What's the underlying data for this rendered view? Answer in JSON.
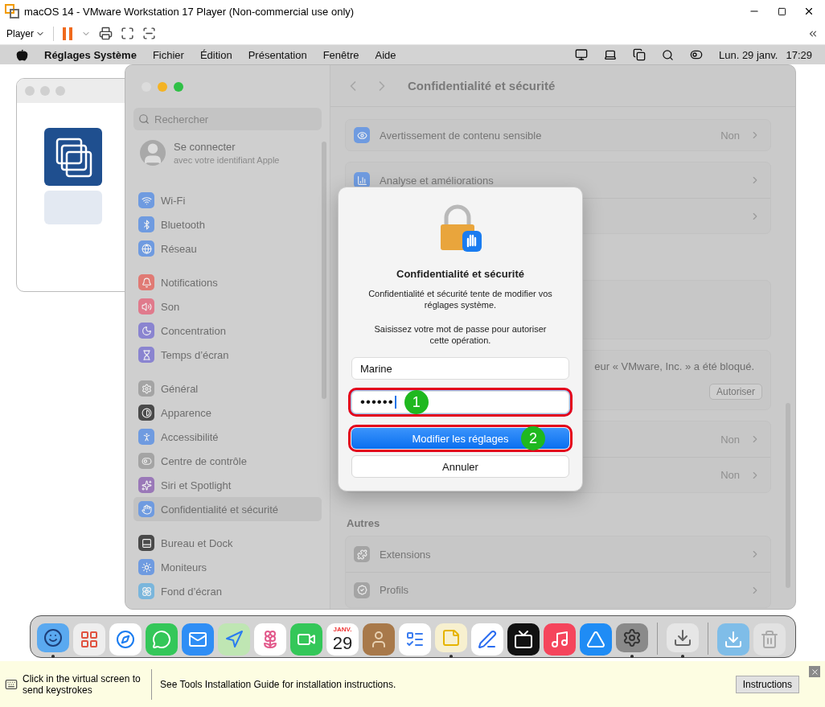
{
  "host_window": {
    "title": "macOS 14 - VMware Workstation 17 Player (Non-commercial use only)"
  },
  "toolbar": {
    "player_menu": "Player"
  },
  "menu_bar": {
    "app": "Réglages Système",
    "items": [
      "Fichier",
      "Édition",
      "Présentation",
      "Fenêtre",
      "Aide"
    ],
    "date": "Lun. 29 janv.",
    "time": "17:29"
  },
  "settings": {
    "search": {
      "placeholder": "Rechercher"
    },
    "account": {
      "title": "Se connecter",
      "subtitle": "avec votre identifiant Apple"
    },
    "sidebar_groups": [
      [
        {
          "kind": "wifi",
          "label": "Wi-Fi",
          "color": "#6f9be0",
          "selected": false
        },
        {
          "kind": "bluetooth",
          "label": "Bluetooth",
          "color": "#6f9be0",
          "selected": false
        },
        {
          "kind": "globe",
          "label": "Réseau",
          "color": "#6f9be0",
          "selected": false
        }
      ],
      [
        {
          "kind": "bell",
          "label": "Notifications",
          "color": "#e07a74",
          "selected": false
        },
        {
          "kind": "speaker",
          "label": "Son",
          "color": "#e07a8c",
          "selected": false
        },
        {
          "kind": "moon",
          "label": "Concentration",
          "color": "#8a84d0",
          "selected": false
        },
        {
          "kind": "hourglass",
          "label": "Temps d’écran",
          "color": "#8a84d0",
          "selected": false
        }
      ],
      [
        {
          "kind": "gear",
          "label": "Général",
          "color": "#a4a4a4",
          "selected": false
        },
        {
          "kind": "contrast",
          "label": "Apparence",
          "color": "#4a4a4a",
          "selected": false
        },
        {
          "kind": "person",
          "label": "Accessibilité",
          "color": "#6f9be0",
          "selected": false
        },
        {
          "kind": "toggles",
          "label": "Centre de contrôle",
          "color": "#a4a4a4",
          "selected": false
        },
        {
          "kind": "siri",
          "label": "Siri et Spotlight",
          "color": "#9a78b8",
          "selected": false
        },
        {
          "kind": "hand",
          "label": "Confidentialité et sécurité",
          "color": "#6f9be0",
          "selected": true
        }
      ],
      [
        {
          "kind": "dock",
          "label": "Bureau et Dock",
          "color": "#4a4a4a",
          "selected": false
        },
        {
          "kind": "sun",
          "label": "Moniteurs",
          "color": "#6f9be0",
          "selected": false
        },
        {
          "kind": "flower",
          "label": "Fond d’écran",
          "color": "#7ab6dc",
          "selected": false
        }
      ]
    ],
    "content": {
      "title": "Confidentialité et sécurité",
      "cards": [
        {
          "rows": [
            {
              "kind": "eye",
              "label": "Avertissement de contenu sensible",
              "value": "Non"
            }
          ]
        },
        {
          "rows": [
            {
              "kind": "chart",
              "label": "Analyse et améliorations"
            },
            {
              "kind": "blank"
            }
          ]
        },
        {
          "rows": [
            {
              "kind": "empty"
            }
          ]
        },
        {
          "rows": [
            {
              "kind": "notice",
              "label": "eur « VMware, Inc. » a été bloqué.",
              "action": "Autoriser"
            }
          ]
        },
        {
          "rows": [
            {
              "kind": "blank",
              "value": "Non"
            },
            {
              "kind": "blank",
              "value": "Non"
            }
          ]
        },
        {
          "heading": "Autres",
          "rows": [
            {
              "kind": "puzzle",
              "label": "Extensions"
            },
            {
              "kind": "badge",
              "label": "Profils"
            }
          ]
        }
      ]
    }
  },
  "dialog": {
    "title": "Confidentialité et sécurité",
    "message": "Confidentialité et sécurité tente de modifier vos réglages système.",
    "prompt": "Saisissez votre mot de passe pour autoriser cette opération.",
    "username": {
      "value": "Marine",
      "highlighted": false
    },
    "password": {
      "value": "••••••",
      "focused": true,
      "highlighted": true,
      "step": "1"
    },
    "confirm": {
      "label": "Modifier les réglages",
      "highlighted": true,
      "step": "2"
    },
    "cancel": {
      "label": "Annuler"
    }
  },
  "dock": {
    "items": [
      {
        "kind": "finder",
        "running": true
      },
      {
        "kind": "launchpad",
        "running": false
      },
      {
        "kind": "safari",
        "running": false
      },
      {
        "kind": "messages",
        "running": false
      },
      {
        "kind": "mail",
        "running": false
      },
      {
        "kind": "maps",
        "running": false
      },
      {
        "kind": "photos",
        "running": false
      },
      {
        "kind": "facetime",
        "running": false
      },
      {
        "kind": "calendar",
        "running": false,
        "month": "JANV.",
        "day": "29"
      },
      {
        "kind": "contacts",
        "running": false
      },
      {
        "kind": "reminders",
        "running": false
      },
      {
        "kind": "notes",
        "running": true
      },
      {
        "kind": "freeform",
        "running": false
      },
      {
        "kind": "tv",
        "running": false
      },
      {
        "kind": "music",
        "running": false
      },
      {
        "kind": "appstore",
        "running": false
      },
      {
        "kind": "settings",
        "running": true
      },
      {
        "kind": "separator"
      },
      {
        "kind": "installer",
        "running": true
      },
      {
        "kind": "separator"
      },
      {
        "kind": "downloads",
        "running": false
      },
      {
        "kind": "trash",
        "running": false
      }
    ]
  },
  "hint_bar": {
    "hint": "Click in the virtual screen to send keystrokes",
    "message": "See Tools Installation Guide for installation instructions.",
    "button": "Instructions"
  }
}
